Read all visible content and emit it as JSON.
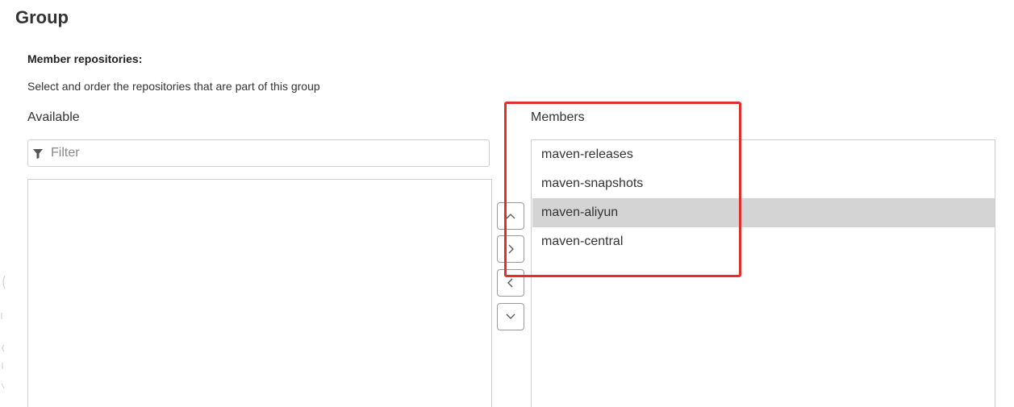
{
  "group": {
    "title": "Group",
    "member_label": "Member repositories:",
    "help_text": "Select and order the repositories that are part of this group",
    "available_label": "Available",
    "members_label": "Members",
    "filter_placeholder": "Filter",
    "filter_value": "",
    "available_items": [],
    "members": [
      {
        "label": "maven-releases",
        "selected": false
      },
      {
        "label": "maven-snapshots",
        "selected": false
      },
      {
        "label": "maven-aliyun",
        "selected": true
      },
      {
        "label": "maven-central",
        "selected": false
      }
    ],
    "buttons": [
      {
        "name": "move-up",
        "icon": "chevron-up-icon"
      },
      {
        "name": "add-to-members",
        "icon": "chevron-right-icon"
      },
      {
        "name": "remove-from-members",
        "icon": "chevron-left-icon"
      },
      {
        "name": "move-down",
        "icon": "chevron-down-icon"
      }
    ]
  },
  "colors": {
    "selected_row": "#d4d4d4",
    "highlight_annotation": "#e0302a",
    "border": "#d0d0d0"
  }
}
